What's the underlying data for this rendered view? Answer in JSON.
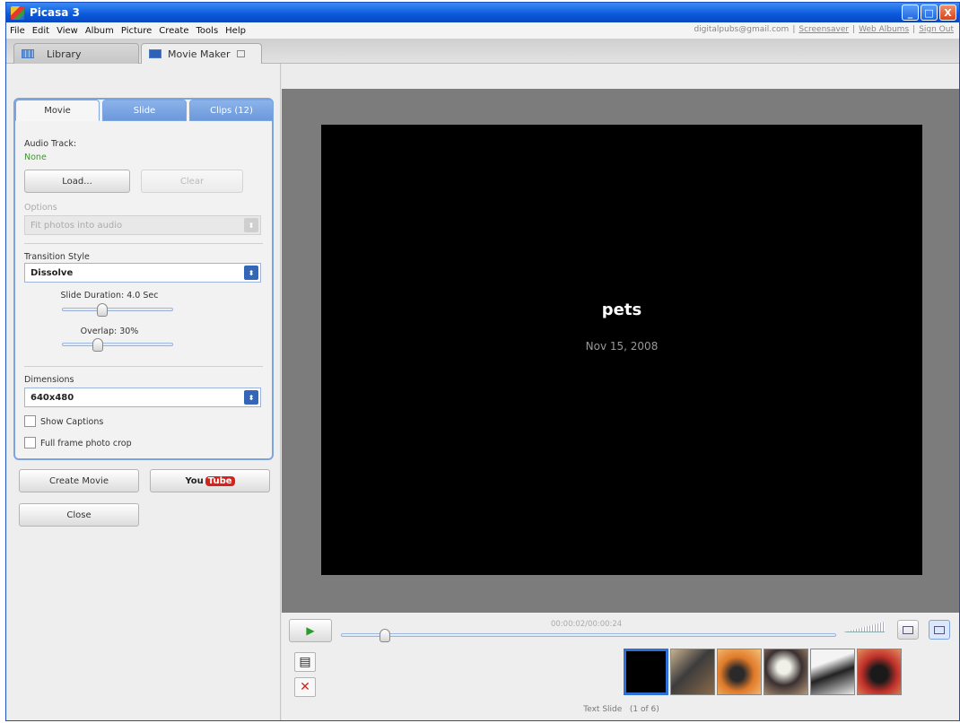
{
  "window": {
    "title": "Picasa 3",
    "controls": [
      "_",
      "□",
      "X"
    ]
  },
  "menu": {
    "items": [
      "File",
      "Edit",
      "View",
      "Album",
      "Picture",
      "Create",
      "Tools",
      "Help"
    ],
    "account": {
      "email": "digitalpubs@gmail.com",
      "links": [
        "Screensaver",
        "Web Albums",
        "Sign Out"
      ]
    }
  },
  "tabs": {
    "library": "Library",
    "movie_maker": "Movie Maker"
  },
  "left": {
    "subtabs": [
      "Movie",
      "Slide",
      "Clips (12)"
    ],
    "audio_track_label": "Audio Track:",
    "audio_track_value": "None",
    "load_button": "Load...",
    "clear_button": "Clear",
    "options_label": "Options",
    "options_value": "Fit photos into audio",
    "transition_label": "Transition Style",
    "transition_value": "Dissolve",
    "slide_duration_label": "Slide Duration: 4.0 Sec",
    "slide_duration_value": 0.35,
    "overlap_label": "Overlap: 30%",
    "overlap_value": 0.3,
    "dimensions_label": "Dimensions",
    "dimensions_value": "640x480",
    "show_captions": "Show Captions",
    "full_frame": "Full frame photo crop",
    "create_movie_button": "Create Movie",
    "youtube_you": "You",
    "youtube_tube": "Tube",
    "close_button": "Close"
  },
  "preview": {
    "title": "pets",
    "date": "Nov 15, 2008"
  },
  "playback": {
    "timecode": "00:00:02/00:00:24",
    "progress": 0.08,
    "status_text": "Text Slide",
    "status_count": "(1 of 6)"
  },
  "colors": {
    "accent": "#2e6fd8",
    "title_bar": "#0a58da",
    "youtube_red": "#d4231c"
  }
}
